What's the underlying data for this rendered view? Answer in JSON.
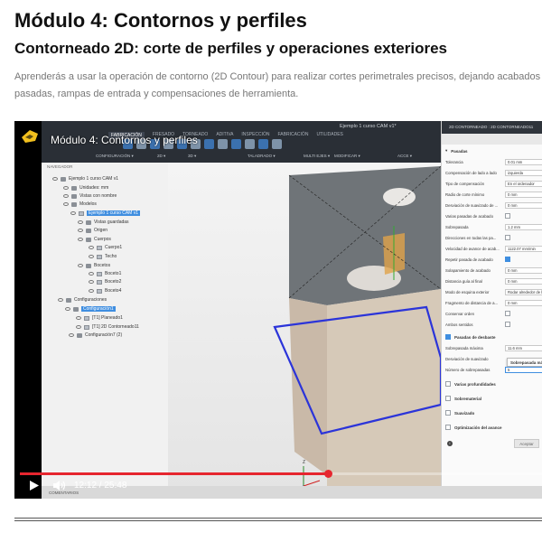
{
  "page": {
    "title": "Módulo 4: Contornos y perfiles",
    "section_title": "Contorneado 2D: corte de perfiles y operaciones exteriores",
    "intro_line1": "Aprenderás a usar la operación de contorno (2D Contour) para realizar cortes perimetrales precisos, dejando acabados limpios",
    "intro_line2": "pasadas, rampas de entrada y compensaciones de herramienta."
  },
  "video": {
    "title": "Módulo 4: Contornos y perfiles",
    "current_time": "12:12",
    "duration": "25:48",
    "time_display": "12:12 / 25:48",
    "progress": 0.59,
    "accent_color": "#e6262f"
  },
  "app": {
    "workspace": "FABRICACIÓN",
    "doc_title": "Ejemplo 1 curso CAM v1*",
    "tabs": [
      "FRESADO",
      "TORNEADO",
      "ADITIVA",
      "INSPECCIÓN",
      "FABRICACIÓN",
      "UTILIDADES"
    ],
    "groups": [
      "CONFIGURACIÓN",
      "2D",
      "3D",
      "TALADRADO",
      "MULTI EJES",
      "MODIFICAR",
      "ACCE"
    ],
    "browser": {
      "header": "NAVEGADOR",
      "rows": [
        {
          "label": "Ejemplo 1 curso CAM v1"
        },
        {
          "label": "Unidades: mm"
        },
        {
          "label": "Vistas con nombre"
        },
        {
          "label": "Modelos"
        },
        {
          "label": "Ejemplo 1 curso CAM v1"
        },
        {
          "label": "Vistas guardadas"
        },
        {
          "label": "Origen"
        },
        {
          "label": "Cuerpos"
        },
        {
          "label": "Cuerpo1"
        },
        {
          "label": "Techo"
        },
        {
          "label": "Bocetos"
        },
        {
          "label": "Boceto1"
        },
        {
          "label": "Boceto2"
        },
        {
          "label": "Boceto4"
        },
        {
          "label": "Configuraciones"
        },
        {
          "label": "Configuración1"
        },
        {
          "label": "[T1] Planeado1"
        },
        {
          "label": "[T1] 2D Contorneado11"
        },
        {
          "label": "Configuración7 (2)"
        }
      ]
    },
    "panel": {
      "header": "2D CONTORNEADO : 2D CONTORNEADO11",
      "section_passes": "Pasadas",
      "rows": [
        {
          "label": "Tolerancia",
          "value": "0.01 mm"
        },
        {
          "label": "Compensación de lado a lado",
          "value": "izquierda"
        },
        {
          "label": "Tipo de compensación",
          "value": "En el ordenador"
        },
        {
          "label": "Radio de corte mínimo",
          "value": "0 mm"
        },
        {
          "label": "Desviación de suavizado de ...",
          "value": "0 mm"
        },
        {
          "label": "Varias pasadas de acabado",
          "value": ""
        },
        {
          "label": "Sobrepasada",
          "value": "1.2 mm"
        },
        {
          "label": "Direcciones en todas las pa...",
          "value": ""
        },
        {
          "label": "Velocidad de avance de acab...",
          "value": "1122.07 mm/min"
        },
        {
          "label": "Repetir pasada de acabado",
          "value": ""
        },
        {
          "label": "Solapamiento de acabado",
          "value": "0 mm"
        },
        {
          "label": "Distancia guía al final",
          "value": "0 mm"
        },
        {
          "label": "Modo de esquina exterior",
          "value": "Rodar alrededor de la esquina"
        },
        {
          "label": "Fragmento de distancia de a...",
          "value": "0 mm"
        },
        {
          "label": "Conservar orden",
          "value": ""
        },
        {
          "label": "Ambos sentidos",
          "value": ""
        }
      ],
      "section_roughing": "Pasadas de desbaste",
      "roughing_rows": [
        {
          "label": "Sobrepasada máxima",
          "value": "11.6 mm"
        },
        {
          "label": "Desviación de suavizado",
          "value": ""
        },
        {
          "label": "Número de sobrepasadas",
          "value": "5"
        }
      ],
      "tooltip": "Sobrepasada máx",
      "sections": [
        "Varias profundidades",
        "Sobrematerial",
        "Suavizado",
        "Optimización del avance"
      ],
      "accept_label": "Aceptar"
    },
    "comments_label": "COMENTARIOS"
  },
  "icons": {
    "logo": "fusion-logo-icon",
    "play": "play-icon",
    "volume": "volume-icon"
  }
}
